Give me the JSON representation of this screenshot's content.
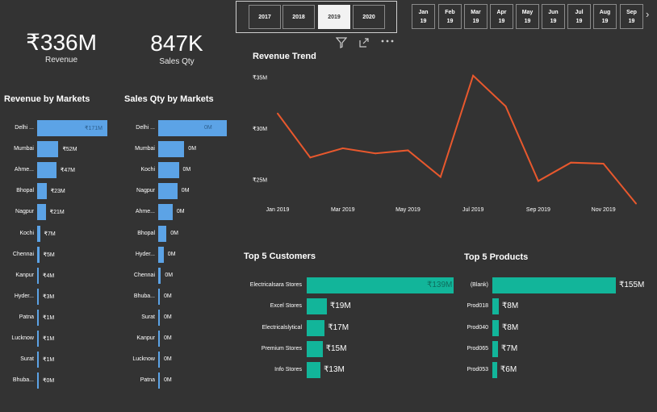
{
  "year_slicer": {
    "years": [
      "2017",
      "2018",
      "2019",
      "2020"
    ],
    "selected": "2019"
  },
  "month_slicer": {
    "months": [
      {
        "month": "Jan",
        "year": "19"
      },
      {
        "month": "Feb",
        "year": "19"
      },
      {
        "month": "Mar",
        "year": "19"
      },
      {
        "month": "Apr",
        "year": "19"
      },
      {
        "month": "May",
        "year": "19"
      },
      {
        "month": "Jun",
        "year": "19"
      },
      {
        "month": "Jul",
        "year": "19"
      },
      {
        "month": "Aug",
        "year": "19"
      },
      {
        "month": "Sep",
        "year": "19"
      }
    ],
    "next_icon": "chevron-right-icon"
  },
  "kpis": {
    "revenue": {
      "value": "₹336M",
      "label": "Revenue"
    },
    "sales_qty": {
      "value": "847K",
      "label": "Sales Qty"
    }
  },
  "visual_header_icons": [
    "filter-icon",
    "focus-mode-icon",
    "more-options-icon"
  ],
  "revenue_by_markets": {
    "title": "Revenue by Markets",
    "rows": [
      {
        "label": "Delhi ...",
        "value": 171,
        "text": "₹171M"
      },
      {
        "label": "Mumbai",
        "value": 52,
        "text": "₹52M"
      },
      {
        "label": "Ahme...",
        "value": 47,
        "text": "₹47M"
      },
      {
        "label": "Bhopal",
        "value": 23,
        "text": "₹23M"
      },
      {
        "label": "Nagpur",
        "value": 21,
        "text": "₹21M"
      },
      {
        "label": "Kochi",
        "value": 7,
        "text": "₹7M"
      },
      {
        "label": "Chennai",
        "value": 5,
        "text": "₹5M"
      },
      {
        "label": "Kanpur",
        "value": 4,
        "text": "₹4M"
      },
      {
        "label": "Hyder...",
        "value": 3,
        "text": "₹3M"
      },
      {
        "label": "Patna",
        "value": 1,
        "text": "₹1M"
      },
      {
        "label": "Lucknow",
        "value": 1,
        "text": "₹1M"
      },
      {
        "label": "Surat",
        "value": 1,
        "text": "₹1M"
      },
      {
        "label": "Bhuba...",
        "value": 0,
        "text": "₹0M"
      }
    ]
  },
  "sales_qty_by_markets": {
    "title": "Sales Qty by Markets",
    "rows": [
      {
        "label": "Delhi ...",
        "value": 100,
        "text": "0M"
      },
      {
        "label": "Mumbai",
        "value": 38,
        "text": "0M"
      },
      {
        "label": "Kochi",
        "value": 30,
        "text": "0M"
      },
      {
        "label": "Nagpur",
        "value": 28,
        "text": "0M"
      },
      {
        "label": "Ahme...",
        "value": 21,
        "text": "0M"
      },
      {
        "label": "Bhopal",
        "value": 12,
        "text": "0M"
      },
      {
        "label": "Hyder...",
        "value": 8,
        "text": "0M"
      },
      {
        "label": "Chennai",
        "value": 4,
        "text": "0M"
      },
      {
        "label": "Bhuba...",
        "value": 2,
        "text": "0M"
      },
      {
        "label": "Surat",
        "value": 2,
        "text": "0M"
      },
      {
        "label": "Kanpur",
        "value": 2,
        "text": "0M"
      },
      {
        "label": "Lucknow",
        "value": 2,
        "text": "0M"
      },
      {
        "label": "Patna",
        "value": 1,
        "text": "0M"
      }
    ]
  },
  "chart_data": {
    "type": "line",
    "title": "Revenue Trend",
    "color": "#e8582d",
    "x": [
      "Jan 2019",
      "Feb 2019",
      "Mar 2019",
      "Apr 2019",
      "May 2019",
      "Jun 2019",
      "Jul 2019",
      "Aug 2019",
      "Sep 2019",
      "Oct 2019",
      "Nov 2019",
      "Dec 2019"
    ],
    "values": [
      31.5,
      27.2,
      28.1,
      27.6,
      27.9,
      25.3,
      35.2,
      32.2,
      24.9,
      26.7,
      26.6,
      22.7
    ],
    "xticks": [
      "Jan 2019",
      "Mar 2019",
      "May 2019",
      "Jul 2019",
      "Sep 2019",
      "Nov 2019"
    ],
    "yticks": [
      "₹25M",
      "₹30M",
      "₹35M"
    ],
    "ylim": [
      22.5,
      35.5
    ],
    "grid": false
  },
  "top_customers": {
    "title": "Top 5 Customers",
    "rows": [
      {
        "label": "Electricalsara Stores",
        "value": 139,
        "text": "₹139M"
      },
      {
        "label": "Excel Stores",
        "value": 19,
        "text": "₹19M"
      },
      {
        "label": "Electricalslytical",
        "value": 17,
        "text": "₹17M"
      },
      {
        "label": "Premium Stores",
        "value": 15,
        "text": "₹15M"
      },
      {
        "label": "Info Stores",
        "value": 13,
        "text": "₹13M"
      }
    ]
  },
  "top_products": {
    "title": "Top 5 Products",
    "rows": [
      {
        "label": "(Blank)",
        "value": 155,
        "text": "₹155M"
      },
      {
        "label": "Prod018",
        "value": 8,
        "text": "₹8M"
      },
      {
        "label": "Prod040",
        "value": 8,
        "text": "₹8M"
      },
      {
        "label": "Prod065",
        "value": 7,
        "text": "₹7M"
      },
      {
        "label": "Prod053",
        "value": 6,
        "text": "₹6M"
      }
    ]
  }
}
